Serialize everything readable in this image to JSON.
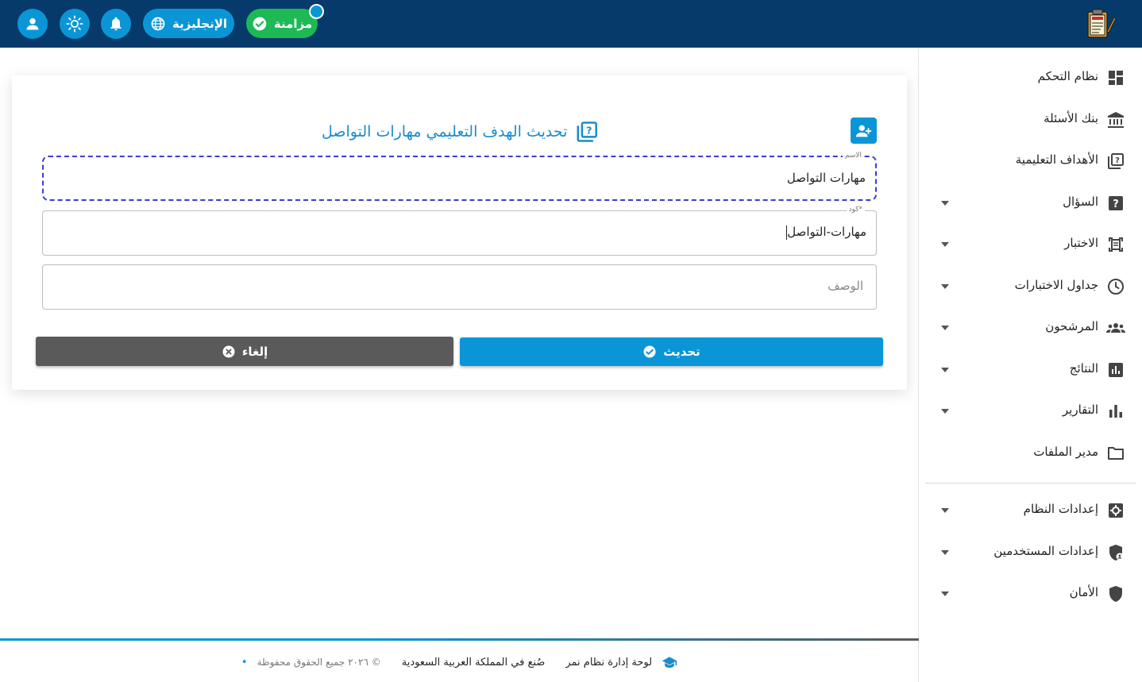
{
  "topbar": {
    "sync_label": "مزامنة",
    "language_label": "الإنجليزية",
    "icons": [
      "user-icon",
      "brightness-icon",
      "bell-icon",
      "globe-icon",
      "check-circle-icon"
    ],
    "colors": {
      "bar": "#063a6b",
      "accent": "#0a96d6",
      "success": "#1db954"
    }
  },
  "sidebar": {
    "items": [
      {
        "label": "نظام التحكم",
        "icon": "dashboard-icon",
        "expandable": false
      },
      {
        "label": "بنك الأسئلة",
        "icon": "bank-icon",
        "expandable": false
      },
      {
        "label": "الأهداف التعليمية",
        "icon": "quiz-icon",
        "expandable": false
      },
      {
        "label": "السؤال",
        "icon": "help-box-icon",
        "expandable": true
      },
      {
        "label": "الاختبار",
        "icon": "exam-icon",
        "expandable": true
      },
      {
        "label": "جداول الاختبارات",
        "icon": "clock-icon",
        "expandable": true
      },
      {
        "label": "المرشحون",
        "icon": "people-icon",
        "expandable": true
      },
      {
        "label": "النتائج",
        "icon": "poll-icon",
        "expandable": true
      },
      {
        "label": "التقارير",
        "icon": "bar-chart-icon",
        "expandable": true
      },
      {
        "label": "مدير الملفات",
        "icon": "folder-icon",
        "expandable": false
      }
    ],
    "settings": [
      {
        "label": "إعدادات النظام",
        "icon": "settings-icon",
        "expandable": true
      },
      {
        "label": "إعدادات المستخدمين",
        "icon": "shield-user-icon",
        "expandable": true
      },
      {
        "label": "الأمان",
        "icon": "shield-icon",
        "expandable": true
      }
    ]
  },
  "form": {
    "title": "تحديث الهدف التعليمي مهارات التواصل",
    "name_label": "الاسم",
    "name_value": "مهارات التواصل",
    "code_label": "كود*",
    "code_value": "مهارات-التواصل",
    "description_placeholder": "الوصف",
    "update_label": "تحديث",
    "cancel_label": "إلغاء"
  },
  "footer": {
    "brand": "لوحة إدارة نظام نمر",
    "made_in": "صُنع في المملكة العربية السعودية",
    "copyright": "© ٢٠٢٦ جميع الحقوق محفوظة",
    "separator": "•"
  }
}
